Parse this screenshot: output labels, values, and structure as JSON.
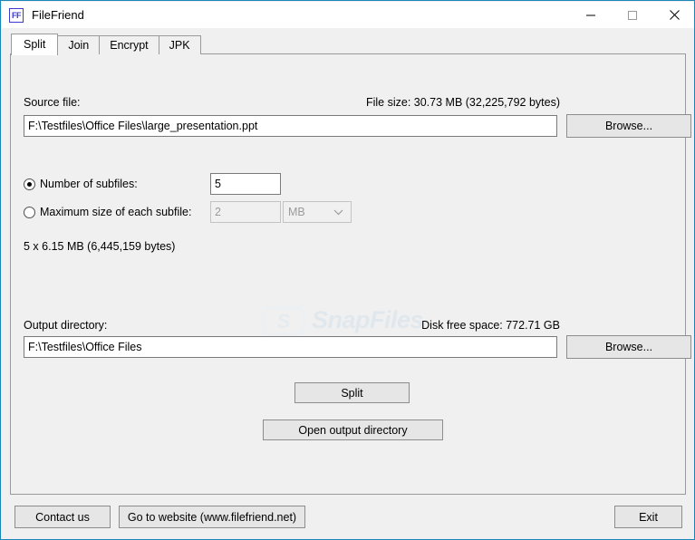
{
  "window": {
    "title": "FileFriend",
    "icon_label": "FF",
    "icon_name": "filefriend-app-icon",
    "accent_color": "#1b87b8",
    "controls": [
      {
        "name": "minimize-button",
        "glyph": "minimize-icon"
      },
      {
        "name": "maximize-button",
        "glyph": "maximize-icon"
      },
      {
        "name": "close-button",
        "glyph": "close-icon"
      }
    ]
  },
  "tabs": [
    {
      "label": "Split",
      "active": true
    },
    {
      "label": "Join",
      "active": false
    },
    {
      "label": "Encrypt",
      "active": false
    },
    {
      "label": "JPK",
      "active": false
    }
  ],
  "split": {
    "source_label": "Source file:",
    "file_size_label": "File size: 30.73 MB (32,225,792 bytes)",
    "source_path": "F:\\Testfiles\\Office Files\\large_presentation.ppt",
    "source_browse_label": "Browse...",
    "number_of_subfiles_label": "Number of subfiles:",
    "number_of_subfiles_value": "5",
    "max_size_label": "Maximum size of each subfile:",
    "max_size_value": "2",
    "max_size_unit": "MB",
    "summary": "5 x 6.15 MB (6,445,159 bytes)",
    "output_label": "Output directory:",
    "disk_free_label": "Disk free space: 772.71 GB",
    "output_path": "F:\\Testfiles\\Office Files",
    "output_browse_label": "Browse...",
    "split_button_label": "Split",
    "open_output_button_label": "Open output directory",
    "watermark_text": "SnapFiles",
    "watermark_mark": "S"
  },
  "footer": {
    "contact_label": "Contact us",
    "website_label": "Go to website (www.filefriend.net)",
    "exit_label": "Exit"
  }
}
